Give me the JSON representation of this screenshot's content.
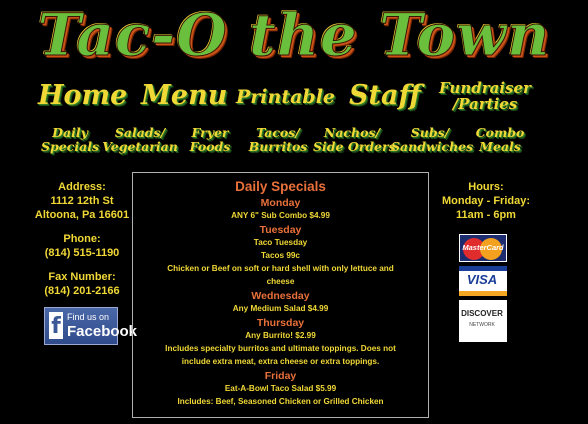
{
  "site": {
    "logo": "Tac-O the Town"
  },
  "nav_primary": [
    {
      "label": "Home"
    },
    {
      "label": "Menu"
    },
    {
      "label": "Printable"
    },
    {
      "label": "Staff"
    },
    {
      "label_line1": "Fundraiser",
      "label_line2": "/Parties"
    }
  ],
  "nav_secondary": [
    {
      "line1": "Daily",
      "line2": "Specials"
    },
    {
      "line1": "Salads/",
      "line2": "Vegetarian"
    },
    {
      "line1": "Fryer",
      "line2": "Foods"
    },
    {
      "line1": "Tacos/",
      "line2": "Burritos"
    },
    {
      "line1": "Nachos/",
      "line2": "Side Orders"
    },
    {
      "line1": "Subs/",
      "line2": "Sandwiches"
    },
    {
      "line1": "Combo",
      "line2": "Meals"
    }
  ],
  "contact": {
    "address_label": "Address:",
    "address_line1": "1112 12th St",
    "address_line2": "Altoona, Pa 16601",
    "phone_label": "Phone:",
    "phone": "(814) 515-1190",
    "fax_label": "Fax Number:",
    "fax": "(814) 201-2166"
  },
  "facebook": {
    "line1": "Find us on",
    "line2": "Facebook"
  },
  "specials": {
    "title": "Daily Specials",
    "days": [
      {
        "day": "Monday",
        "lines": [
          "ANY 6\" Sub Combo $4.99"
        ]
      },
      {
        "day": "Tuesday",
        "lines": [
          "Taco Tuesday",
          "Tacos 99c",
          "Chicken or Beef on soft or hard shell with only lettuce and",
          "cheese"
        ]
      },
      {
        "day": "Wednesday",
        "lines": [
          "Any Medium Salad $4.99"
        ]
      },
      {
        "day": "Thursday",
        "lines": [
          "Any Burrito! $2.99",
          "Includes specialty burritos and ultimate toppings. Does not",
          "include extra meat, extra cheese or extra toppings."
        ]
      },
      {
        "day": "Friday",
        "lines": [
          "Eat-A-Bowl Taco Salad $5.99",
          "Includes: Beef, Seasoned Chicken or Grilled Chicken"
        ]
      }
    ]
  },
  "hours": {
    "label": "Hours:",
    "days": "Monday - Friday:",
    "time": "11am - 6pm"
  },
  "cards": {
    "mastercard": "MasterCard",
    "visa": "VISA",
    "discover": "DISCOVER",
    "discover_sub": "NETWORK"
  },
  "colors": {
    "accent_orange": "#e8703a",
    "text_yellow": "#f0d836",
    "logo_green": "#6abf3c"
  }
}
